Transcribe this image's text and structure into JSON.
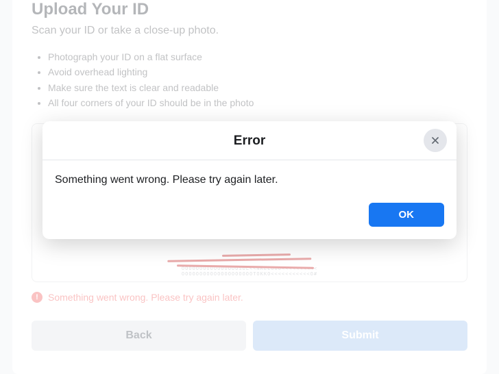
{
  "page": {
    "title": "Upload Your ID",
    "subtitle": "Scan your ID or take a close-up photo.",
    "tips": [
      "Photograph your ID on a flat surface",
      "Avoid overhead lighting",
      "Make sure the text is clear and readable",
      "All four corners of your ID should be in the photo"
    ],
    "inline_error": "Something went wrong. Please try again later.",
    "buttons": {
      "back": "Back",
      "submit": "Submit"
    }
  },
  "modal": {
    "title": "Error",
    "message": "Something went wrong. Please try again later.",
    "ok_label": "OK"
  },
  "colors": {
    "primary": "#1877f2",
    "primary_disabled": "#a8c7f0",
    "error": "#f36a6a"
  }
}
